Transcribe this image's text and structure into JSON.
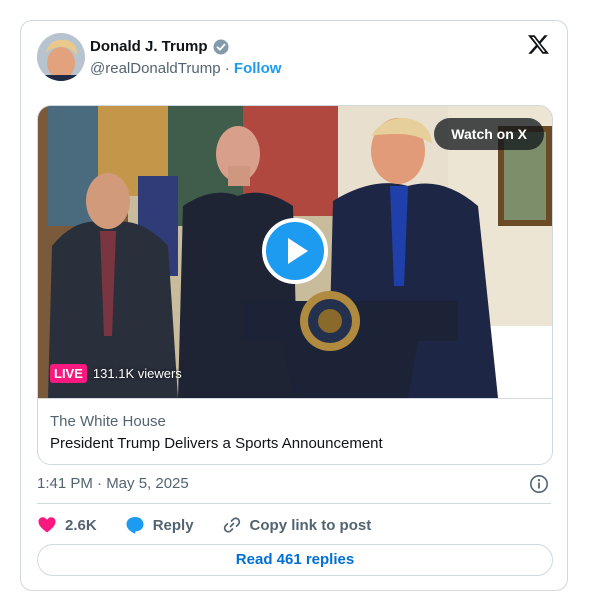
{
  "author": {
    "name": "Donald J. Trump",
    "handle": "@realDonaldTrump",
    "separator": "·",
    "follow_label": "Follow"
  },
  "icons": {
    "x_logo": "x-logo-icon",
    "verified": "verified-badge-icon",
    "play": "play-icon",
    "info": "info-icon",
    "like": "heart-icon",
    "reply": "reply-bubble-icon",
    "link": "link-icon"
  },
  "media": {
    "watch_label": "Watch on X",
    "live_label": "LIVE",
    "viewers": "131.1K viewers",
    "source": "The White House",
    "title": "President Trump Delivers a Sports Announcement"
  },
  "timestamp": "1:41 PM · May 5, 2025",
  "actions": {
    "likes": "2.6K",
    "reply_label": "Reply",
    "copy_label": "Copy link to post"
  },
  "read_replies": "Read 461 replies",
  "colors": {
    "accent": "#1d9bf0",
    "like": "#f91880",
    "live": "#f91880",
    "link_button": "#006fd6",
    "muted": "#536471",
    "verified": "#829aab"
  }
}
